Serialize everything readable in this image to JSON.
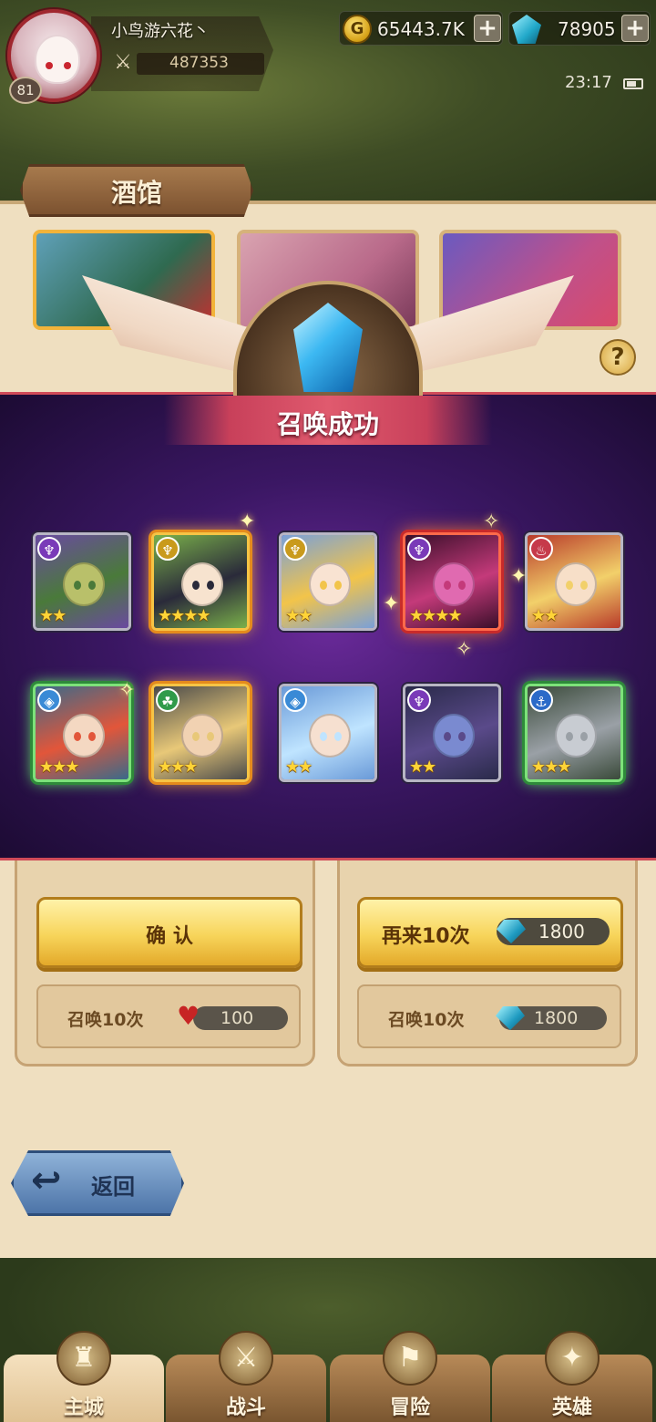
{
  "player": {
    "name": "小鸟游六花丶",
    "level": "81",
    "power": "487353"
  },
  "resources": {
    "gold": "65443.7K",
    "gems": "78905"
  },
  "status": {
    "time": "23:17"
  },
  "tavern": {
    "title": "酒馆"
  },
  "summon_result": {
    "title": "召唤成功",
    "heroes": [
      {
        "faction": "purple",
        "stars": 2,
        "frame": "normal",
        "art": "goblin-wizard"
      },
      {
        "faction": "gold",
        "stars": 4,
        "frame": "gold",
        "art": "dark-haired-girl"
      },
      {
        "faction": "gold",
        "stars": 2,
        "frame": "normal",
        "art": "blonde-priestess"
      },
      {
        "faction": "purple",
        "stars": 4,
        "frame": "red",
        "art": "pink-demon"
      },
      {
        "faction": "red",
        "stars": 2,
        "frame": "normal",
        "art": "blonde-knight"
      },
      {
        "faction": "blue",
        "stars": 3,
        "frame": "green",
        "art": "red-haired-ninja"
      },
      {
        "faction": "green",
        "stars": 3,
        "frame": "gold",
        "art": "blond-warrior"
      },
      {
        "faction": "blue",
        "stars": 2,
        "frame": "normal",
        "art": "blue-hooded-mage"
      },
      {
        "faction": "purple",
        "stars": 2,
        "frame": "normal",
        "art": "masked-elf"
      },
      {
        "faction": "navy",
        "stars": 3,
        "frame": "green",
        "art": "armored-knight"
      }
    ]
  },
  "actions": {
    "confirm_label": "确 认",
    "again_label": "再来10次",
    "again_cost": "1800"
  },
  "summon_cards": {
    "left_label": "召唤10次",
    "left_cost": "100",
    "right_label": "召唤10次",
    "right_cost": "1800"
  },
  "back_label": "返回",
  "nav": {
    "items": [
      {
        "label": "主城"
      },
      {
        "label": "战斗"
      },
      {
        "label": "冒险"
      },
      {
        "label": "英雄"
      }
    ]
  },
  "colors": {
    "overlay_purple": "#3b1764",
    "gold_frame": "#f6c445",
    "red_accent": "#d04a58"
  }
}
